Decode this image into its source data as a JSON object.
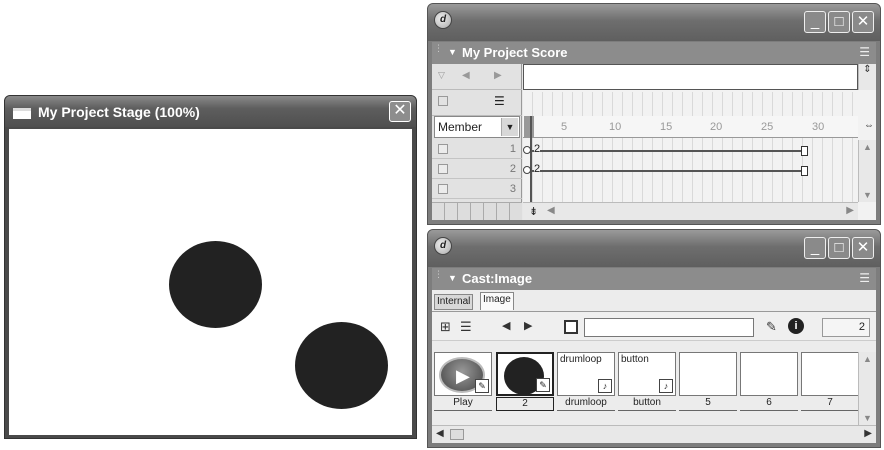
{
  "stage": {
    "title": "My Project Stage (100%)",
    "close_label": "✕"
  },
  "score": {
    "title": "My Project Score",
    "member_label": "Member",
    "ruler": [
      "5",
      "10",
      "15",
      "20",
      "25",
      "30"
    ],
    "channels": [
      "1",
      "2",
      "3"
    ],
    "sprites": [
      {
        "channel": "1",
        "label": "2"
      },
      {
        "channel": "2",
        "label": "2"
      }
    ]
  },
  "cast": {
    "title": "Cast:Image",
    "tabs": [
      "Internal",
      "Image"
    ],
    "selected_number": "2",
    "members": [
      {
        "thumb_name": "",
        "caption": "Play"
      },
      {
        "thumb_name": "",
        "caption": "2"
      },
      {
        "thumb_name": "drumloop",
        "caption": "drumloop"
      },
      {
        "thumb_name": "button",
        "caption": "button"
      },
      {
        "thumb_name": "",
        "caption": "5"
      },
      {
        "thumb_name": "",
        "caption": "6"
      },
      {
        "thumb_name": "",
        "caption": "7"
      }
    ]
  },
  "window_buttons": {
    "minimize": "_",
    "maximize": "□",
    "close": "✕"
  },
  "colors": {
    "title_gray": "#5e5e5e",
    "circle": "#222222"
  }
}
